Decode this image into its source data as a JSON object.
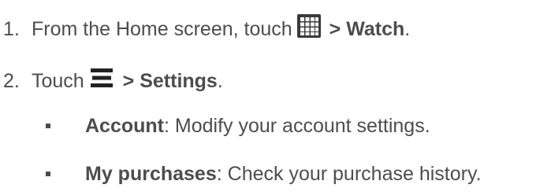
{
  "steps": [
    {
      "number": "1.",
      "text_before": "From the Home screen, touch",
      "icon": "apps-grid-icon",
      "text_bold": " > Watch",
      "text_after": "."
    },
    {
      "number": "2.",
      "text_before": "Touch",
      "icon": "menu-icon",
      "text_bold": " > Settings",
      "text_after": "."
    }
  ],
  "bullets": [
    {
      "term": "Account",
      "description": ": Modify your account settings."
    },
    {
      "term": "My purchases",
      "description": ": Check your purchase history."
    }
  ]
}
